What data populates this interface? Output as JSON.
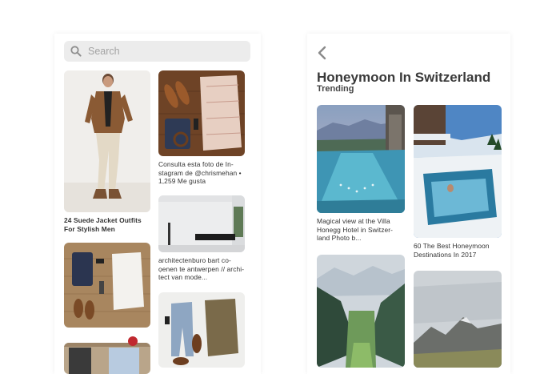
{
  "left_screen": {
    "search": {
      "placeholder": "Search"
    },
    "pins": [
      {
        "caption": "24 Suede Jacket Outfits For Stylish Men"
      },
      {
        "caption": ""
      },
      {
        "caption": ""
      },
      {
        "caption": "Consulta esta foto de In-stagram de @chrismehan • 1,259 Me gusta"
      },
      {
        "caption": "architectenburo bart co-ọenen te antwerpen // archi-tect van mode..."
      },
      {
        "caption": ""
      }
    ]
  },
  "right_screen": {
    "back_icon": "chevron-left-icon",
    "title": "Honeymoon In Switzerland",
    "subtitle": "Trending",
    "pins": [
      {
        "caption": "Magical view at the Villa Honegg Hotel in Switzer-land Photo b..."
      },
      {
        "caption": "60 The Best Honeymoon Destinations In 2017"
      },
      {
        "caption": ""
      },
      {
        "caption": ""
      }
    ]
  },
  "colors": {
    "search_bg": "#ececec",
    "text": "#333333",
    "accent_red": "#c0282f"
  }
}
